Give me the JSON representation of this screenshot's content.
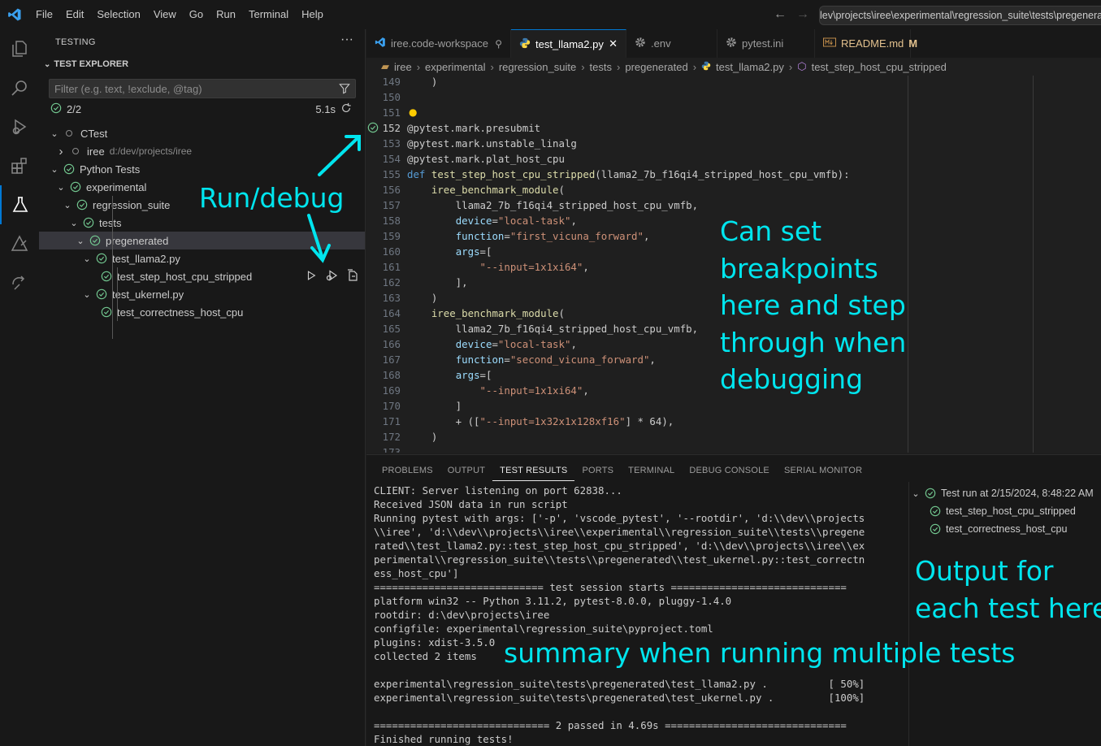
{
  "menu": [
    "File",
    "Edit",
    "Selection",
    "View",
    "Go",
    "Run",
    "Terminal",
    "Help"
  ],
  "command_center": "lev\\projects\\iree\\experimental\\regression_suite\\tests\\pregenerate",
  "activity_icons": [
    "explorer-icon",
    "search-icon",
    "run-debug-icon",
    "extensions-icon",
    "testing-icon",
    "remote-icon",
    "share-icon"
  ],
  "sidebar": {
    "title": "TESTING",
    "section": "TEST EXPLORER",
    "filter_placeholder": "Filter (e.g. text, !exclude, @tag)",
    "summary": "2/2",
    "duration": "5.1s",
    "tree": [
      {
        "label": "CTest",
        "path": "",
        "status": "none",
        "depth": 0,
        "expanded": true
      },
      {
        "label": "iree",
        "path": "d:/dev/projects/iree",
        "status": "none",
        "depth": 1,
        "expanded": false
      },
      {
        "label": "Python Tests",
        "path": "",
        "status": "passed",
        "depth": 0,
        "expanded": true
      },
      {
        "label": "experimental",
        "path": "",
        "status": "passed",
        "depth": 1,
        "expanded": true
      },
      {
        "label": "regression_suite",
        "path": "",
        "status": "passed",
        "depth": 2,
        "expanded": true
      },
      {
        "label": "tests",
        "path": "",
        "status": "passed",
        "depth": 3,
        "expanded": true
      },
      {
        "label": "pregenerated",
        "path": "",
        "status": "passed",
        "depth": 4,
        "expanded": true
      },
      {
        "label": "test_llama2.py",
        "path": "",
        "status": "passed",
        "depth": 5,
        "expanded": true
      },
      {
        "label": "test_step_host_cpu_stripped",
        "path": "",
        "status": "passed",
        "depth": 6
      },
      {
        "label": "test_ukernel.py",
        "path": "",
        "status": "passed",
        "depth": 5,
        "expanded": true
      },
      {
        "label": "test_correctness_host_cpu",
        "path": "",
        "status": "passed",
        "depth": 6
      }
    ]
  },
  "tabs": [
    {
      "label": "iree.code-workspace",
      "icon": "vscode-icon",
      "active": false
    },
    {
      "label": "test_llama2.py",
      "icon": "python-icon",
      "active": true
    },
    {
      "label": ".env",
      "icon": "gear-icon",
      "active": false
    },
    {
      "label": "pytest.ini",
      "icon": "gear-icon",
      "active": false
    },
    {
      "label": "README.md",
      "icon": "markdown-icon",
      "active": false,
      "badge": "M"
    }
  ],
  "breadcrumb": [
    "iree",
    "experimental",
    "regression_suite",
    "tests",
    "pregenerated",
    "test_llama2.py",
    "test_step_host_cpu_stripped"
  ],
  "code_lines": [
    {
      "n": "149",
      "text": "    )"
    },
    {
      "n": "150",
      "text": ""
    },
    {
      "n": "151",
      "text": ""
    },
    {
      "n": "152",
      "text": "@pytest.mark.presubmit"
    },
    {
      "n": "153",
      "text": "@pytest.mark.unstable_linalg"
    },
    {
      "n": "154",
      "text": "@pytest.mark.plat_host_cpu"
    },
    {
      "n": "155",
      "text": "def test_step_host_cpu_stripped(llama2_7b_f16qi4_stripped_host_cpu_vmfb):"
    },
    {
      "n": "156",
      "text": "    iree_benchmark_module("
    },
    {
      "n": "157",
      "text": "        llama2_7b_f16qi4_stripped_host_cpu_vmfb,"
    },
    {
      "n": "158",
      "text": "        device=\"local-task\","
    },
    {
      "n": "159",
      "text": "        function=\"first_vicuna_forward\","
    },
    {
      "n": "160",
      "text": "        args=["
    },
    {
      "n": "161",
      "text": "            \"--input=1x1xi64\","
    },
    {
      "n": "162",
      "text": "        ],"
    },
    {
      "n": "163",
      "text": "    )"
    },
    {
      "n": "164",
      "text": "    iree_benchmark_module("
    },
    {
      "n": "165",
      "text": "        llama2_7b_f16qi4_stripped_host_cpu_vmfb,"
    },
    {
      "n": "166",
      "text": "        device=\"local-task\","
    },
    {
      "n": "167",
      "text": "        function=\"second_vicuna_forward\","
    },
    {
      "n": "168",
      "text": "        args=["
    },
    {
      "n": "169",
      "text": "            \"--input=1x1xi64\","
    },
    {
      "n": "170",
      "text": "        ]"
    },
    {
      "n": "171",
      "text": "        + ([\"--input=1x32x1x128xf16\"] * 64),"
    },
    {
      "n": "172",
      "text": "    )"
    },
    {
      "n": "173",
      "text": ""
    }
  ],
  "panel_tabs": [
    "PROBLEMS",
    "OUTPUT",
    "TEST RESULTS",
    "PORTS",
    "TERMINAL",
    "DEBUG CONSOLE",
    "SERIAL MONITOR"
  ],
  "terminal_lines": [
    "CLIENT: Server listening on port 62838...",
    "Received JSON data in run script",
    "Running pytest with args: ['-p', 'vscode_pytest', '--rootdir', 'd:\\\\dev\\\\projects",
    "\\\\iree', 'd:\\\\dev\\\\projects\\\\iree\\\\experimental\\\\regression_suite\\\\tests\\\\pregene",
    "rated\\\\test_llama2.py::test_step_host_cpu_stripped', 'd:\\\\dev\\\\projects\\\\iree\\\\ex",
    "perimental\\\\regression_suite\\\\tests\\\\pregenerated\\\\test_ukernel.py::test_correctn",
    "ess_host_cpu']",
    "============================ test session starts =============================",
    "platform win32 -- Python 3.11.2, pytest-8.0.0, pluggy-1.4.0",
    "rootdir: d:\\dev\\projects\\iree",
    "configfile: experimental\\regression_suite\\pyproject.toml",
    "plugins: xdist-3.5.0",
    "collected 2 items",
    "",
    "experimental\\regression_suite\\tests\\pregenerated\\test_llama2.py .          [ 50%]",
    "experimental\\regression_suite\\tests\\pregenerated\\test_ukernel.py .         [100%]",
    "",
    "============================= 2 passed in 4.69s ==============================",
    "Finished running tests!"
  ],
  "results": {
    "run_label": "Test run at 2/15/2024, 8:48:22 AM",
    "items": [
      "test_step_host_cpu_stripped",
      "test_correctness_host_cpu"
    ]
  },
  "annotations": {
    "run_debug": "Run/debug",
    "breakpoints": [
      "Can set",
      "breakpoints",
      "here and step",
      "through when",
      "debugging"
    ],
    "summary": "summary when running multiple tests",
    "output": [
      "Output for",
      "each test here"
    ]
  },
  "colors": {
    "annotation": "#00e5ee",
    "passed": "#73c991",
    "accent": "#0078d4"
  }
}
